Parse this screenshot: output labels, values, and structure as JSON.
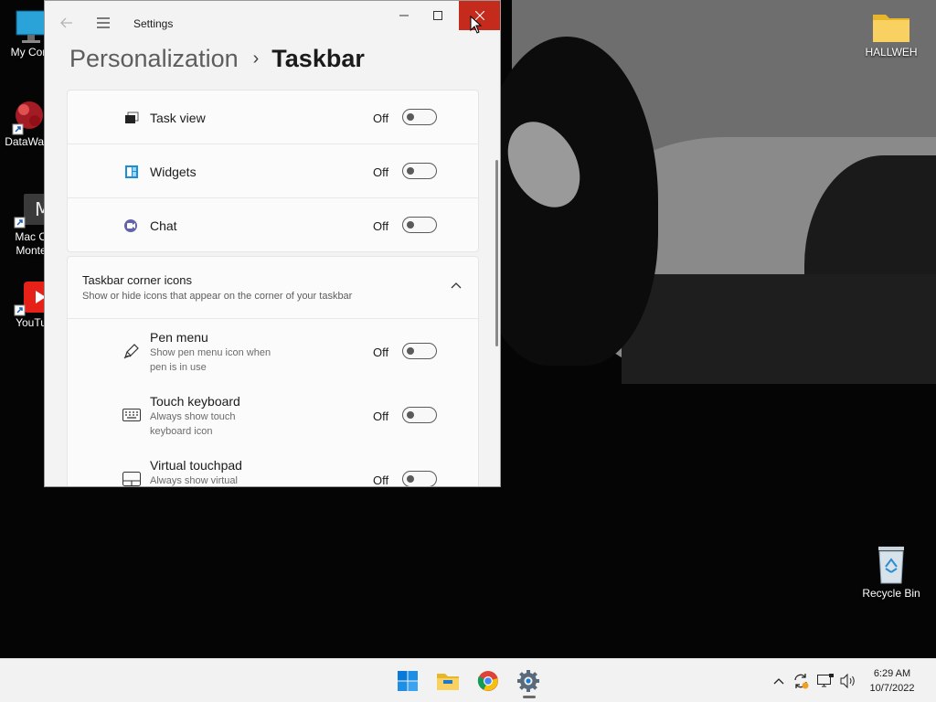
{
  "desktop": {
    "icons": [
      {
        "label": "My Com",
        "icon": "computer-icon"
      },
      {
        "label": "DataWag",
        "icon": "datawag-icon"
      },
      {
        "label": "Mac OS Monte",
        "icon": "mac-os-icon",
        "line1": "Mac O",
        "line2": "Monte"
      },
      {
        "label": "YouTu",
        "icon": "youtube-icon"
      },
      {
        "label": "HALLWEH",
        "icon": "folder-icon"
      },
      {
        "label": "Recycle Bin",
        "icon": "recycle-bin-icon"
      }
    ]
  },
  "window": {
    "title": "Settings",
    "breadcrumb": {
      "parent": "Personalization",
      "separator": "›",
      "current": "Taskbar"
    }
  },
  "taskbar_items": [
    {
      "label": "Task view",
      "state": "Off",
      "on": false,
      "icon": "task-view-icon"
    },
    {
      "label": "Widgets",
      "state": "Off",
      "on": false,
      "icon": "widgets-icon"
    },
    {
      "label": "Chat",
      "state": "Off",
      "on": false,
      "icon": "chat-icon"
    }
  ],
  "corner_icons": {
    "title": "Taskbar corner icons",
    "subtitle": "Show or hide icons that appear on the corner of your taskbar",
    "items": [
      {
        "label": "Pen menu",
        "desc": "Show pen menu icon when pen is in use",
        "state": "Off",
        "on": false,
        "icon": "pen-icon"
      },
      {
        "label": "Touch keyboard",
        "desc": "Always show touch keyboard icon",
        "state": "Off",
        "on": false,
        "icon": "keyboard-icon"
      },
      {
        "label": "Virtual touchpad",
        "desc": "Always show virtual",
        "state": "Off",
        "on": false,
        "icon": "touchpad-icon"
      }
    ]
  },
  "system_taskbar": {
    "apps": [
      "start-icon",
      "file-explorer-icon",
      "chrome-icon",
      "settings-icon"
    ],
    "tray": [
      "show-hidden-icons-chevron",
      "sync-icon",
      "network-icon",
      "volume-icon"
    ],
    "time": "6:29 AM",
    "date": "10/7/2022"
  },
  "colors": {
    "close_hover": "#c42b1c",
    "accent": "#0067c0"
  }
}
